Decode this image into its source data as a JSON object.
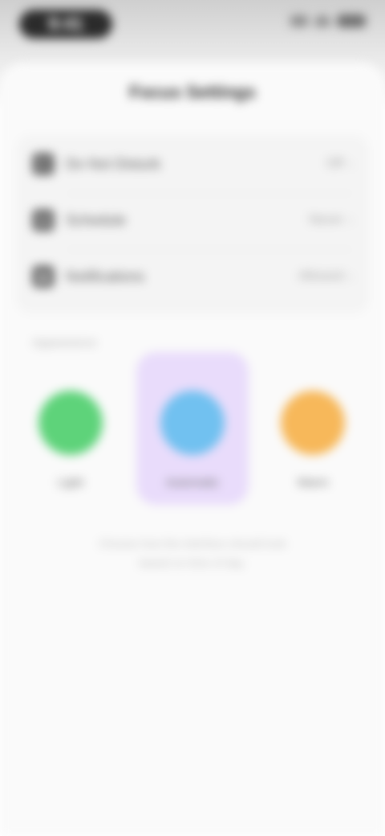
{
  "status": {
    "time": "9:41"
  },
  "sheet": {
    "title": "Focus Settings",
    "rows": [
      {
        "icon": "moon-icon",
        "label": "Do Not Disturb",
        "value": "Off"
      },
      {
        "icon": "clock-icon",
        "label": "Schedule",
        "value": "Never"
      },
      {
        "icon": "bell-icon",
        "label": "Notifications",
        "value": "Allowed"
      }
    ],
    "section_label": "Appearance",
    "options": [
      {
        "label": "Light",
        "color": "#5ed37a",
        "selected": false
      },
      {
        "label": "Automatic",
        "color": "#71c1f0",
        "selected": true
      },
      {
        "label": "Warm",
        "color": "#f7b85a",
        "selected": false
      }
    ],
    "footnote_line1": "Choose how the interface should look",
    "footnote_line2": "based on time of day."
  }
}
